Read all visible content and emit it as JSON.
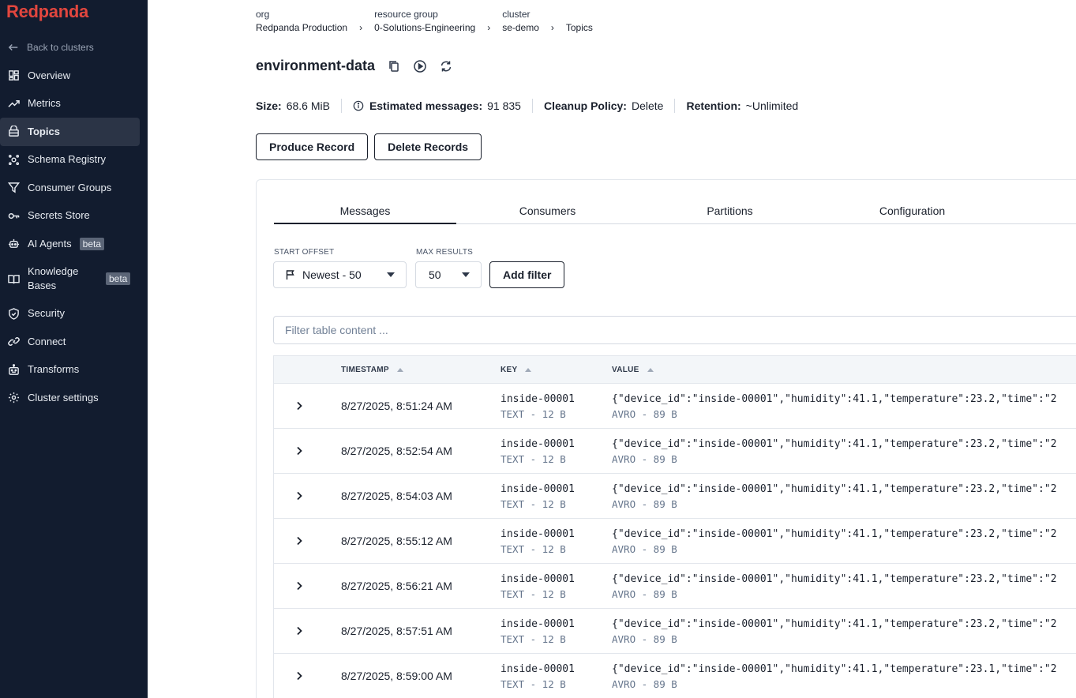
{
  "sidebar": {
    "logo": "Redpanda",
    "back_label": "Back to clusters",
    "items": [
      {
        "label": "Overview",
        "icon": "dashboard-icon"
      },
      {
        "label": "Metrics",
        "icon": "trend-icon"
      },
      {
        "label": "Topics",
        "icon": "topic-icon",
        "active": true
      },
      {
        "label": "Schema Registry",
        "icon": "schema-icon"
      },
      {
        "label": "Consumer Groups",
        "icon": "filter-icon"
      },
      {
        "label": "Secrets Store",
        "icon": "key-icon"
      },
      {
        "label": "AI Agents",
        "icon": "bot-icon",
        "badge": "beta"
      },
      {
        "label": "Knowledge Bases",
        "icon": "book-icon",
        "badge": "beta"
      },
      {
        "label": "Security",
        "icon": "shield-icon"
      },
      {
        "label": "Connect",
        "icon": "link-icon"
      },
      {
        "label": "Transforms",
        "icon": "robot-icon"
      },
      {
        "label": "Cluster settings",
        "icon": "gear-icon"
      }
    ]
  },
  "breadcrumb": {
    "org_key": "org",
    "org_value": "Redpanda Production",
    "rg_key": "resource group",
    "rg_value": "0-Solutions-Engineering",
    "cluster_key": "cluster",
    "cluster_value": "se-demo",
    "current": "Topics"
  },
  "topic": {
    "name": "environment-data"
  },
  "stats": {
    "size_label": "Size:",
    "size_value": "68.6 MiB",
    "messages_label": "Estimated messages:",
    "messages_value": "91 835",
    "cleanup_label": "Cleanup Policy:",
    "cleanup_value": "Delete",
    "retention_label": "Retention:",
    "retention_value": "~Unlimited"
  },
  "actions": {
    "produce": "Produce Record",
    "delete": "Delete Records"
  },
  "tabs": [
    "Messages",
    "Consumers",
    "Partitions",
    "Configuration"
  ],
  "controls": {
    "start_offset_label": "START OFFSET",
    "start_offset_value": "Newest - 50",
    "max_results_label": "MAX RESULTS",
    "max_results_value": "50",
    "add_filter": "Add filter",
    "filter_placeholder": "Filter table content ..."
  },
  "table": {
    "columns": [
      "TIMESTAMP",
      "KEY",
      "VALUE"
    ],
    "rows": [
      {
        "timestamp": "8/27/2025, 8:51:24 AM",
        "key": "inside-00001",
        "key_meta": "TEXT - 12 B",
        "value": "{\"device_id\":\"inside-00001\",\"humidity\":41.1,\"temperature\":23.2,\"time\":\"2",
        "value_meta": "AVRO - 89 B"
      },
      {
        "timestamp": "8/27/2025, 8:52:54 AM",
        "key": "inside-00001",
        "key_meta": "TEXT - 12 B",
        "value": "{\"device_id\":\"inside-00001\",\"humidity\":41.1,\"temperature\":23.2,\"time\":\"2",
        "value_meta": "AVRO - 89 B"
      },
      {
        "timestamp": "8/27/2025, 8:54:03 AM",
        "key": "inside-00001",
        "key_meta": "TEXT - 12 B",
        "value": "{\"device_id\":\"inside-00001\",\"humidity\":41.1,\"temperature\":23.2,\"time\":\"2",
        "value_meta": "AVRO - 89 B"
      },
      {
        "timestamp": "8/27/2025, 8:55:12 AM",
        "key": "inside-00001",
        "key_meta": "TEXT - 12 B",
        "value": "{\"device_id\":\"inside-00001\",\"humidity\":41.1,\"temperature\":23.2,\"time\":\"2",
        "value_meta": "AVRO - 89 B"
      },
      {
        "timestamp": "8/27/2025, 8:56:21 AM",
        "key": "inside-00001",
        "key_meta": "TEXT - 12 B",
        "value": "{\"device_id\":\"inside-00001\",\"humidity\":41.1,\"temperature\":23.2,\"time\":\"2",
        "value_meta": "AVRO - 89 B"
      },
      {
        "timestamp": "8/27/2025, 8:57:51 AM",
        "key": "inside-00001",
        "key_meta": "TEXT - 12 B",
        "value": "{\"device_id\":\"inside-00001\",\"humidity\":41.1,\"temperature\":23.2,\"time\":\"2",
        "value_meta": "AVRO - 89 B"
      },
      {
        "timestamp": "8/27/2025, 8:59:00 AM",
        "key": "inside-00001",
        "key_meta": "TEXT - 12 B",
        "value": "{\"device_id\":\"inside-00001\",\"humidity\":41.1,\"temperature\":23.1,\"time\":\"2",
        "value_meta": "AVRO - 89 B"
      }
    ]
  },
  "colors": {
    "sidebar_bg": "#121c2f",
    "brand": "#e2463e",
    "active_item": "#2b3446"
  }
}
